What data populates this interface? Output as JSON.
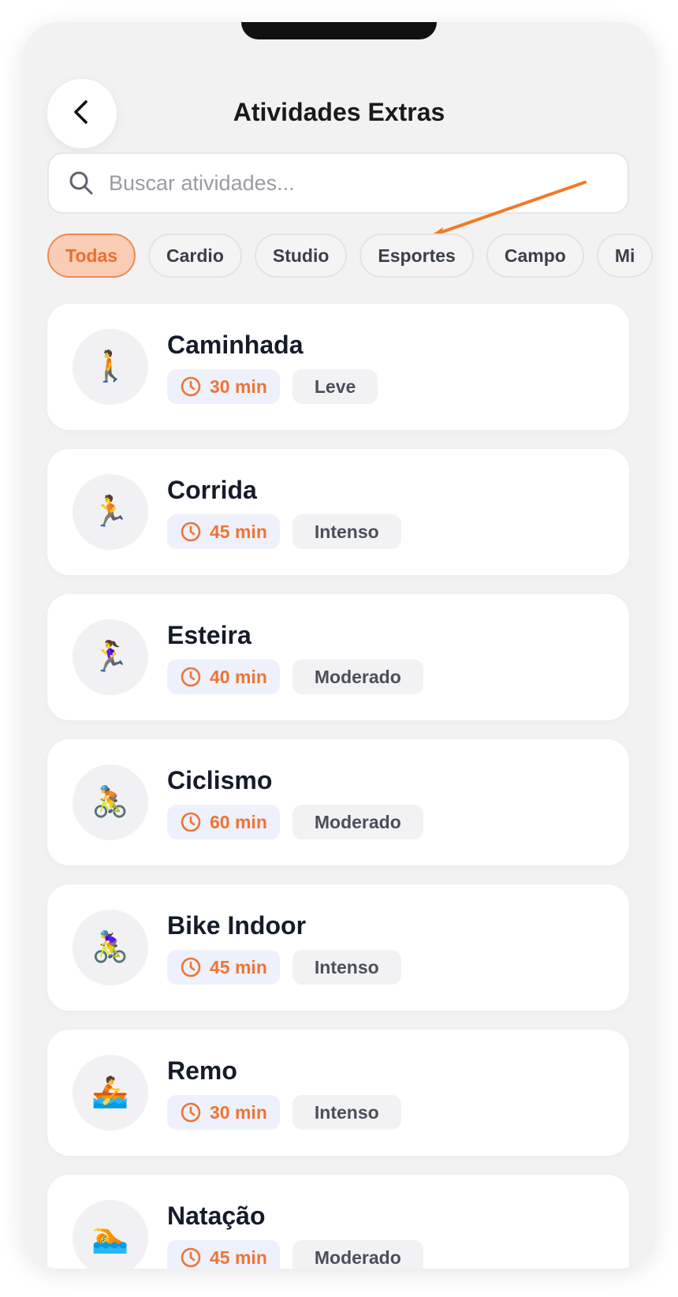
{
  "header": {
    "title": "Atividades Extras",
    "back_icon": "chevron-left-icon"
  },
  "search": {
    "placeholder": "Buscar atividades...",
    "icon": "search-icon"
  },
  "filters": [
    {
      "label": "Todas",
      "active": true
    },
    {
      "label": "Cardio",
      "active": false
    },
    {
      "label": "Studio",
      "active": false
    },
    {
      "label": "Esportes",
      "active": false
    },
    {
      "label": "Campo",
      "active": false
    },
    {
      "label": "Mi",
      "active": false
    }
  ],
  "activities": [
    {
      "name": "Caminhada",
      "duration": "30 min",
      "level": "Leve",
      "emoji": "🚶"
    },
    {
      "name": "Corrida",
      "duration": "45 min",
      "level": "Intenso",
      "emoji": "🏃"
    },
    {
      "name": "Esteira",
      "duration": "40 min",
      "level": "Moderado",
      "emoji": "🏃‍♀️"
    },
    {
      "name": "Ciclismo",
      "duration": "60 min",
      "level": "Moderado",
      "emoji": "🚴"
    },
    {
      "name": "Bike Indoor",
      "duration": "45 min",
      "level": "Intenso",
      "emoji": "🚴‍♀️"
    },
    {
      "name": "Remo",
      "duration": "30 min",
      "level": "Intenso",
      "emoji": "🚣"
    },
    {
      "name": "Natação",
      "duration": "45 min",
      "level": "Moderado",
      "emoji": "🏊"
    }
  ],
  "colors": {
    "accent": "#EE7435",
    "chip_active_bg": "#F9CCB4",
    "background": "#F2F2F2",
    "card": "#FFFFFF",
    "annotation_arrow": "#F07A26"
  }
}
